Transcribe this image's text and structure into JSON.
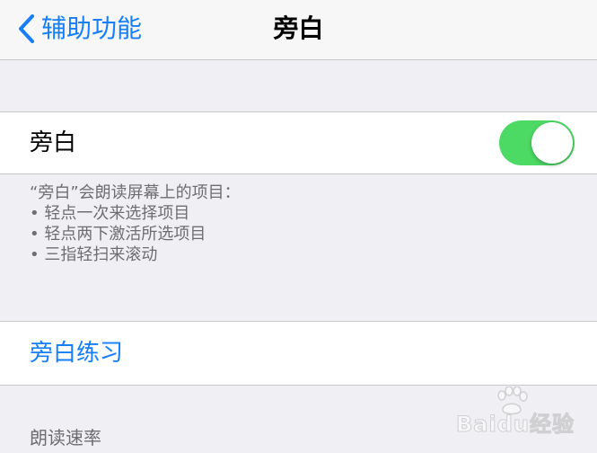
{
  "nav": {
    "back_label": "辅助功能",
    "title": "旁白"
  },
  "voiceover": {
    "label": "旁白",
    "enabled": true,
    "toggle_color": "#4cd964"
  },
  "description": {
    "intro": "“旁白”会朗读屏幕上的项目：",
    "items": [
      "• 轻点一次来选择项目",
      "• 轻点两下激活所选项目",
      "• 三指轻扫来滚动"
    ]
  },
  "practice": {
    "label": "旁白练习"
  },
  "speaking_rate": {
    "header": "朗读速率"
  },
  "watermark": {
    "text": "Baidu经验"
  },
  "colors": {
    "accent": "#157efb",
    "background": "#efeff4",
    "footer_text": "#6d6d72"
  }
}
